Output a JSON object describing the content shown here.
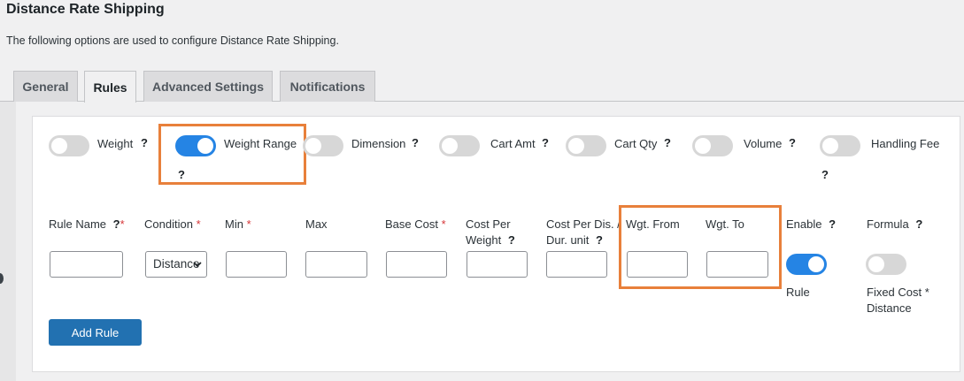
{
  "page": {
    "title": "Distance Rate Shipping",
    "description": "The following options are used to configure Distance Rate Shipping."
  },
  "tabs": [
    {
      "label": "General"
    },
    {
      "label": "Rules"
    },
    {
      "label": "Advanced Settings"
    },
    {
      "label": "Notifications"
    }
  ],
  "toggles": [
    {
      "label": "Weight",
      "help": "?",
      "on": false
    },
    {
      "label": "Weight Range",
      "help": "?",
      "on": true
    },
    {
      "label": "Dimension",
      "help": "?",
      "on": false
    },
    {
      "label": "Cart Amt",
      "help": "?",
      "on": false
    },
    {
      "label": "Cart Qty",
      "help": "?",
      "on": false
    },
    {
      "label": "Volume",
      "help": "?",
      "on": false
    },
    {
      "label": "Handling Fee",
      "help": "?",
      "on": false
    }
  ],
  "columns": {
    "rule_name": {
      "label": "Rule Name",
      "help": "?",
      "required": "*"
    },
    "condition": {
      "label": "Condition",
      "required": "*"
    },
    "min": {
      "label": "Min",
      "required": "*"
    },
    "max": {
      "label": "Max"
    },
    "base_cost": {
      "label": "Base Cost",
      "required": "*"
    },
    "cost_per_weight": {
      "line1": "Cost Per",
      "line2": "Weight",
      "help": "?"
    },
    "cost_per_dis": {
      "line1": "Cost Per Dis. /",
      "line2": "Dur. unit",
      "help": "?"
    },
    "wgt_from": {
      "label": "Wgt. From"
    },
    "wgt_to": {
      "label": "Wgt. To"
    },
    "enable": {
      "label": "Enable",
      "help": "?"
    },
    "formula": {
      "label": "Formula",
      "help": "?"
    }
  },
  "row": {
    "rule_name": "",
    "condition_value": "Distance",
    "min": "",
    "max": "",
    "base_cost": "",
    "cost_per_weight": "",
    "cost_per_dis": "",
    "wgt_from": "",
    "wgt_to": "",
    "enable_on": true,
    "enable_caption": "Rule",
    "formula_on": false,
    "formula_caption_line1": "Fixed Cost *",
    "formula_caption_line2": "Distance"
  },
  "buttons": {
    "add_rule": "Add Rule"
  },
  "colors": {
    "accent": "#2584e4",
    "button": "#2271b1",
    "highlight": "#e8803b",
    "required": "#d63638"
  }
}
